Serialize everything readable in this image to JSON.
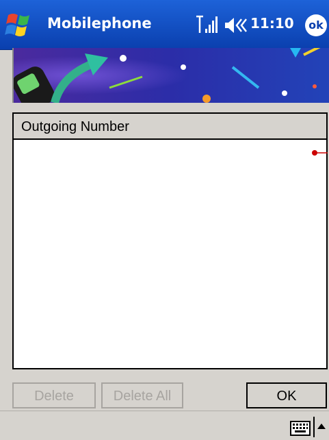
{
  "titlebar": {
    "app_title": "Mobilephone",
    "clock": "11:10",
    "ok_label": "ok",
    "start_icon": "windows-flag-icon",
    "signal_icon": "signal-strength-icon",
    "volume_icon": "speaker-volume-icon",
    "color": "#0a3fae"
  },
  "list": {
    "column_header": "Outgoing Number",
    "rows": []
  },
  "buttons": {
    "delete_label": "Delete",
    "delete_all_label": "Delete All",
    "ok_label": "OK"
  },
  "bottombar": {
    "keyboard_icon": "keyboard-icon",
    "sip_icon": "sip-arrow-up-icon"
  }
}
